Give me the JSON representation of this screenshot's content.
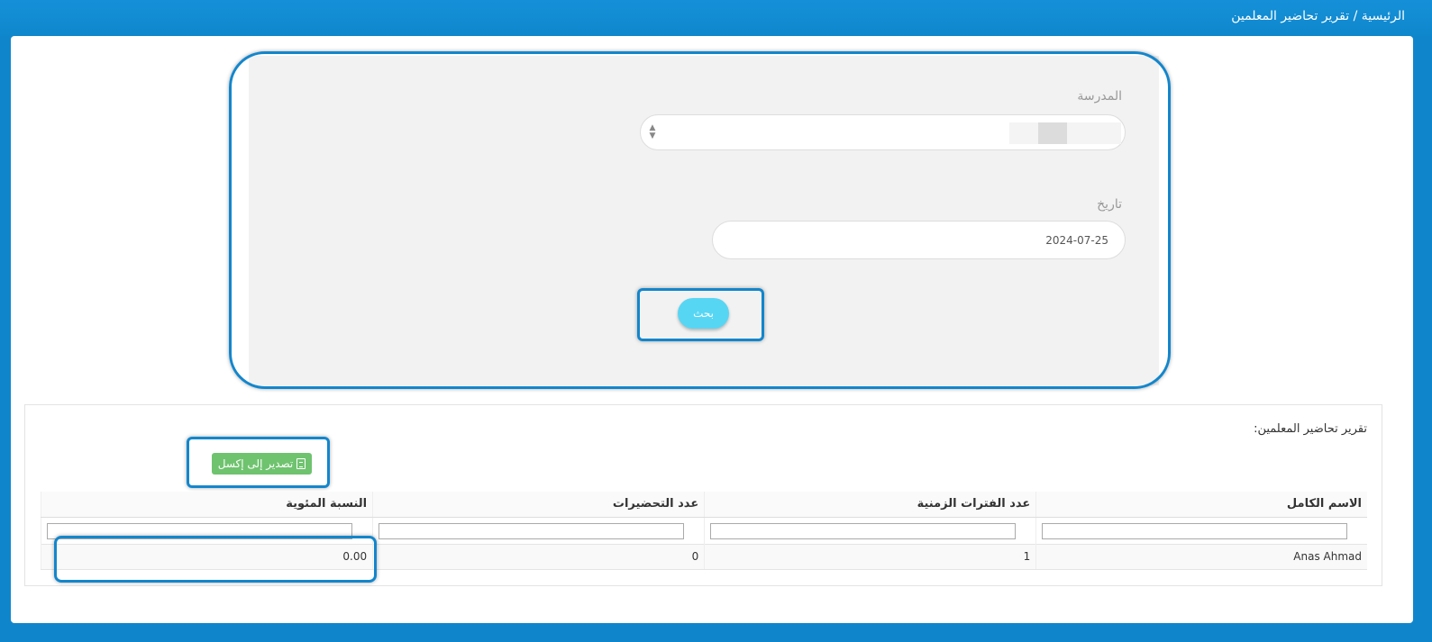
{
  "breadcrumb": {
    "home": "الرئيسية",
    "separator": "/",
    "current": "تقرير تحاضير المعلمين"
  },
  "search_form": {
    "school_label": "المدرسة",
    "school_value": "",
    "date_label": "تاريخ",
    "date_value": "2024-07-25",
    "search_button": "بحث"
  },
  "report": {
    "title": "تقرير تحاضير المعلمين:",
    "export_button": "تصدير إلى إكسل",
    "export_icon": "excel-file-icon",
    "columns": [
      "الاسم الكامل",
      "عدد الفترات الزمنية",
      "عدد التحضيرات",
      "النسبة المئوية"
    ],
    "rows": [
      [
        "Anas Ahmad",
        "1",
        "0",
        "0.00"
      ]
    ]
  },
  "colors": {
    "brand_blue": "#0f86cc",
    "search_button": "#57d6f4",
    "export_button": "#6fc36f",
    "highlight_border": "#1386cc"
  }
}
